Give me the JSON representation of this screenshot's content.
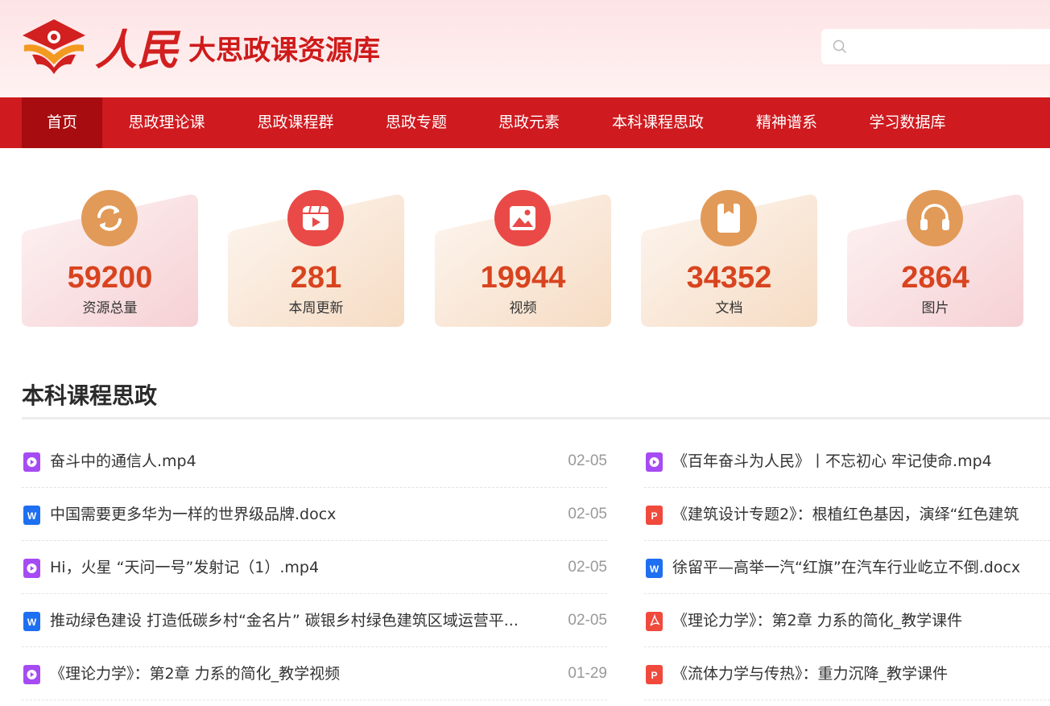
{
  "site": {
    "logo_script": "人民",
    "logo_text": "大思政课资源库"
  },
  "search": {
    "value": "",
    "placeholder": ""
  },
  "nav": {
    "items": [
      {
        "label": "首页",
        "active": true
      },
      {
        "label": "思政理论课"
      },
      {
        "label": "思政课程群"
      },
      {
        "label": "思政专题"
      },
      {
        "label": "思政元素"
      },
      {
        "label": "本科课程思政"
      },
      {
        "label": "精神谱系"
      },
      {
        "label": "学习数据库"
      }
    ]
  },
  "stats": [
    {
      "value": "59200",
      "label": "资源总量",
      "icon": "refresh-icon"
    },
    {
      "value": "281",
      "label": "本周更新",
      "icon": "video-update-icon"
    },
    {
      "value": "19944",
      "label": "视频",
      "icon": "image-icon"
    },
    {
      "value": "34352",
      "label": "文档",
      "icon": "document-icon"
    },
    {
      "value": "2864",
      "label": "图片",
      "icon": "headphones-icon"
    }
  ],
  "section": {
    "title": "本科课程思政",
    "left": [
      {
        "type": "video",
        "title": "奋斗中的通信人.mp4",
        "date": "02-05"
      },
      {
        "type": "word",
        "title": "中国需要更多华为一样的世界级品牌.docx",
        "date": "02-05"
      },
      {
        "type": "video",
        "title": "Hi，火星 “天问一号”发射记（1）.mp4",
        "date": "02-05"
      },
      {
        "type": "word",
        "title": "推动绿色建设 打造低碳乡村“金名片” 碳银乡村绿色建筑区域运营平...",
        "date": "02-05"
      },
      {
        "type": "video",
        "title": "《理论力学》：第2章 力系的简化_教学视频",
        "date": "01-29"
      }
    ],
    "right": [
      {
        "type": "video",
        "title": "《百年奋斗为人民》丨不忘初心 牢记使命.mp4"
      },
      {
        "type": "ppt",
        "title": "《建筑设计专题2》：根植红色基因，演绎“红色建筑"
      },
      {
        "type": "word",
        "title": "徐留平—高举一汽“红旗”在汽车行业屹立不倒.docx"
      },
      {
        "type": "pdf",
        "title": "《理论力学》：第2章 力系的简化_教学课件"
      },
      {
        "type": "ppt",
        "title": "《流体力学与传热》：重力沉降_教学课件"
      }
    ]
  },
  "colors": {
    "brand_red": "#cf1a1f",
    "nav_active": "#a70d10",
    "stat_value": "#d8441f",
    "video_icon": "#a64bf4",
    "word_icon": "#1e6ff1",
    "ppt_icon": "#f04a3d",
    "pdf_icon": "#f04a3d"
  }
}
